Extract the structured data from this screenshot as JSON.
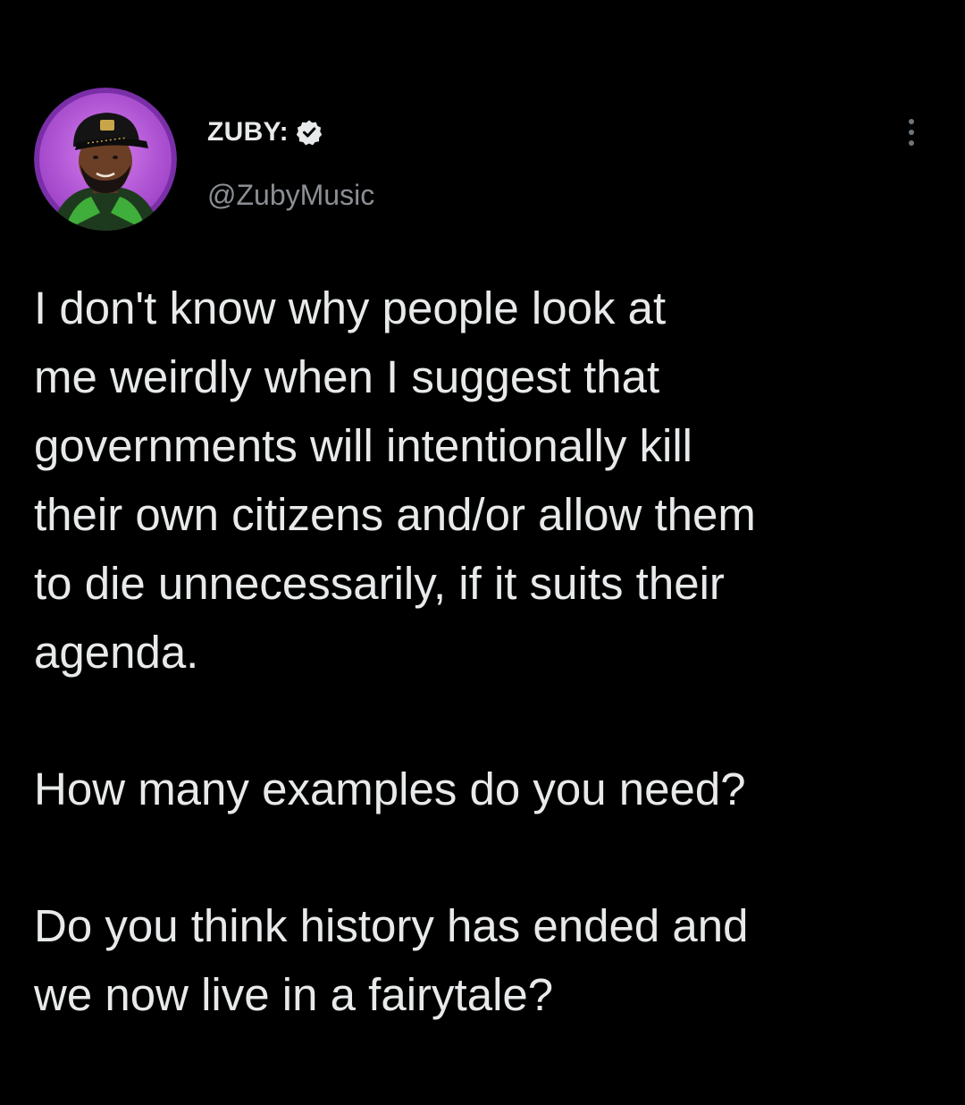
{
  "tweet": {
    "author": {
      "display_name": "ZUBY:",
      "handle": "@ZubyMusic",
      "verified": true,
      "avatar_ring_color": "#b04ad6"
    },
    "paragraphs": [
      "I don't know why people look at\nme weirdly when I suggest that\ngovernments will intentionally kill\ntheir own citizens and/or allow them\nto die unnecessarily, if it suits their\nagenda.",
      "How many examples do you need?",
      "Do you think history has ended and\nwe now live in a fairytale?"
    ],
    "more_icon": "more-vertical-icon"
  },
  "colors": {
    "background": "#000000",
    "text_primary": "#e7e9ea",
    "text_secondary": "#8b8f94"
  }
}
